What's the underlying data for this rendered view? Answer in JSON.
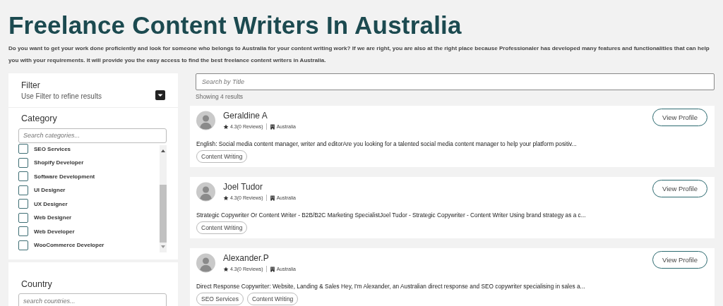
{
  "title": "Freelance Content Writers In Australia",
  "intro": "Do you want to get your work done proficiently and look for someone who belongs to Australia for your content writing work? If we are right, you are also at the right place because Professionaler has developed many features and functionalities that can help you with your requirements. It will provide you the easy access to find the best freelance content writers in Australia.",
  "filter": {
    "title": "Filter",
    "subtitle": "Use Filter to refine results"
  },
  "category": {
    "title": "Category",
    "placeholder": "Search categories...",
    "items": [
      {
        "label": "SEO Services",
        "checked": false
      },
      {
        "label": "Shopify Developer",
        "checked": false
      },
      {
        "label": "Software Development",
        "checked": false
      },
      {
        "label": "UI Designer",
        "checked": false
      },
      {
        "label": "UX Designer",
        "checked": false
      },
      {
        "label": "Web Designer",
        "checked": false
      },
      {
        "label": "Web Developer",
        "checked": false
      },
      {
        "label": "WooCommerce Developer",
        "checked": false
      }
    ]
  },
  "country": {
    "title": "Country",
    "placeholder": "search countries..."
  },
  "search": {
    "placeholder": "Search by Title"
  },
  "results_count": "Showing 4 results",
  "profiles": [
    {
      "name": "Geraldine A",
      "rating": "4.3(0 Reviews)",
      "location": "Australia",
      "summary": "English: Social media content manager, writer and editorAre you looking for a talented social media content manager to help your platform positiv...",
      "tags": [
        "Content Writing"
      ],
      "button": "View Profile"
    },
    {
      "name": "Joel Tudor",
      "rating": "4.3(0 Reviews)",
      "location": "Australia",
      "summary": "Strategic Copywriter Or Content Writer - B2B/B2C Marketing SpecialistJoel Tudor - Strategic Copywriter - Content Writer Using brand strategy as a c...",
      "tags": [
        "Content Writing"
      ],
      "button": "View Profile"
    },
    {
      "name": "Alexander.P",
      "rating": "4.3(0 Reviews)",
      "location": "Australia",
      "summary": "Direct Response Copywriter: Website, Landing & Sales Hey, I'm Alexander, an Australian direct response and SEO copywriter specialising in sales a...",
      "tags": [
        "SEO Services",
        "Content Writing"
      ],
      "button": "View Profile"
    }
  ]
}
